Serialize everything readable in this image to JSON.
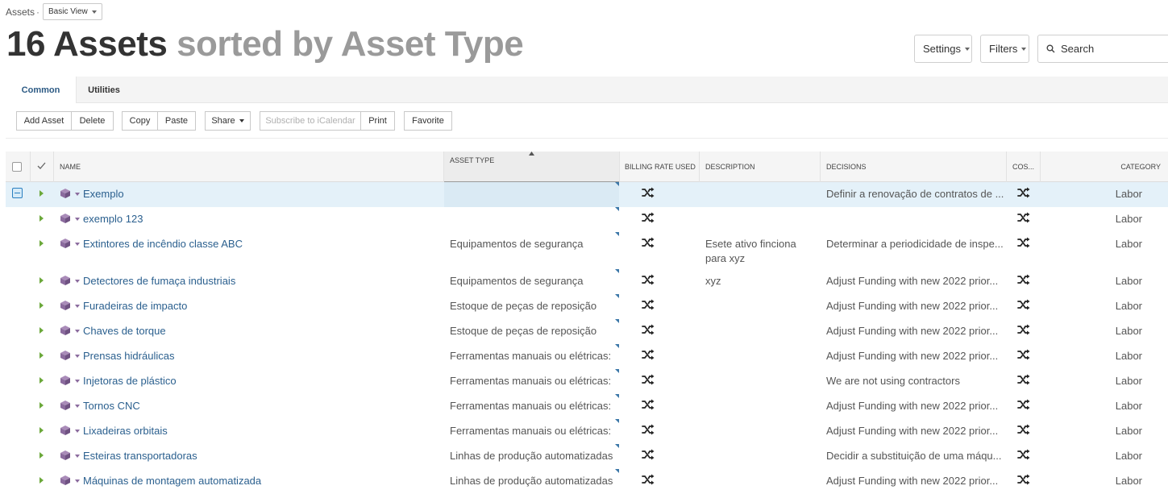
{
  "breadcrumb": {
    "root": "Assets",
    "separator": "·",
    "view": "Basic View"
  },
  "title": {
    "count": "16 Assets",
    "sort": "sorted by Asset Type"
  },
  "controls": {
    "settings": "Settings",
    "filters": "Filters",
    "search_placeholder": "Search"
  },
  "tabs": [
    {
      "label": "Common",
      "active": true
    },
    {
      "label": "Utilities",
      "active": false
    }
  ],
  "toolbar": {
    "add_asset": "Add Asset",
    "delete": "Delete",
    "copy": "Copy",
    "paste": "Paste",
    "share": "Share",
    "subscribe": "Subscribe to iCalendar",
    "print": "Print",
    "favorite": "Favorite"
  },
  "columns": {
    "name": "NAME",
    "asset_type": "ASSET TYPE",
    "billing_rate": "BILLING RATE USED",
    "description": "DESCRIPTION",
    "decisions": "DECISIONS",
    "cost": "COS...",
    "category": "CATEGORY"
  },
  "rows": [
    {
      "name": "Exemplo",
      "asset_type": "",
      "description": "",
      "description2": "",
      "decisions": "Definir a renovação de contratos de ...",
      "category": "Labor"
    },
    {
      "name": "exemplo 123",
      "asset_type": "",
      "description": "",
      "description2": "",
      "decisions": "",
      "category": "Labor"
    },
    {
      "name": "Extintores de incêndio classe ABC",
      "asset_type": "Equipamentos de segurança",
      "description": "Esete ativo finciona",
      "description2": "para xyz",
      "decisions": "Determinar a periodicidade de inspe...",
      "category": "Labor"
    },
    {
      "name": "Detectores de fumaça industriais",
      "asset_type": "Equipamentos de segurança",
      "description": "xyz",
      "description2": "",
      "decisions": "Adjust Funding with new 2022 prior...",
      "category": "Labor"
    },
    {
      "name": "Furadeiras de impacto",
      "asset_type": "Estoque de peças de reposição",
      "description": "",
      "description2": "",
      "decisions": "Adjust Funding with new 2022 prior...",
      "category": "Labor"
    },
    {
      "name": "Chaves de torque",
      "asset_type": "Estoque de peças de reposição",
      "description": "",
      "description2": "",
      "decisions": "Adjust Funding with new 2022 prior...",
      "category": "Labor"
    },
    {
      "name": "Prensas hidráulicas",
      "asset_type": "Ferramentas manuais ou elétricas:",
      "description": "",
      "description2": "",
      "decisions": "Adjust Funding with new 2022 prior...",
      "category": "Labor"
    },
    {
      "name": "Injetoras de plástico",
      "asset_type": "Ferramentas manuais ou elétricas:",
      "description": "",
      "description2": "",
      "decisions": "We are not using contractors",
      "category": "Labor"
    },
    {
      "name": "Tornos CNC",
      "asset_type": "Ferramentas manuais ou elétricas:",
      "description": "",
      "description2": "",
      "decisions": "Adjust Funding with new 2022 prior...",
      "category": "Labor"
    },
    {
      "name": "Lixadeiras orbitais",
      "asset_type": "Ferramentas manuais ou elétricas:",
      "description": "",
      "description2": "",
      "decisions": "Adjust Funding with new 2022 prior...",
      "category": "Labor"
    },
    {
      "name": "Esteiras transportadoras",
      "asset_type": "Linhas de produção automatizadas",
      "description": "",
      "description2": "",
      "decisions": "Decidir a substituição de uma máqu...",
      "category": "Labor"
    },
    {
      "name": "Máquinas de montagem automatizada",
      "asset_type": "Linhas de produção automatizadas",
      "description": "",
      "description2": "",
      "decisions": "Adjust Funding with new 2022 prior...",
      "category": "Labor"
    }
  ],
  "icons": {
    "row_icon": "cube-icon",
    "billing_icon": "shuffle-icon",
    "cost_icon": "shuffle-icon"
  },
  "colors": {
    "link": "#2a5f8e",
    "accent": "#2c5a84",
    "selected_row": "#e4f1f9",
    "expander": "#6ba83a",
    "cube": "#8b6b9e"
  }
}
